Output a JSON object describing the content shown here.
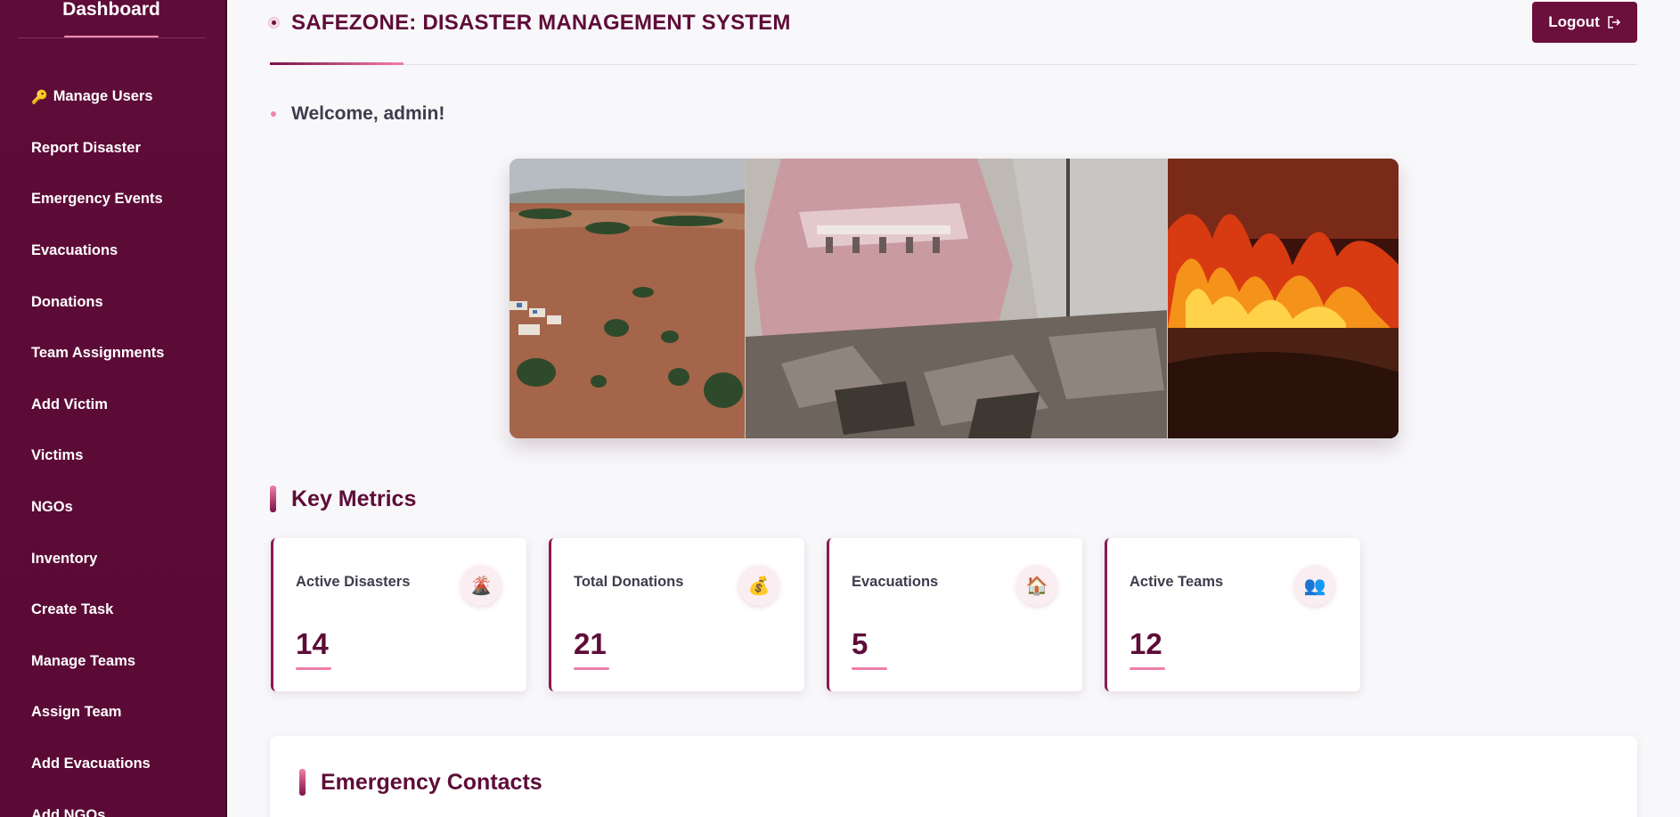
{
  "sidebar": {
    "title": "Dashboard",
    "items": [
      {
        "label": "Manage Users",
        "icon": "key-icon"
      },
      {
        "label": "Report Disaster"
      },
      {
        "label": "Emergency Events"
      },
      {
        "label": "Evacuations"
      },
      {
        "label": "Donations"
      },
      {
        "label": "Team Assignments"
      },
      {
        "label": "Add Victim"
      },
      {
        "label": "Victims"
      },
      {
        "label": "NGOs"
      },
      {
        "label": "Inventory"
      },
      {
        "label": "Create Task"
      },
      {
        "label": "Manage Teams"
      },
      {
        "label": "Assign Team"
      },
      {
        "label": "Add Evacuations"
      },
      {
        "label": "Add NGOs"
      }
    ]
  },
  "header": {
    "title": "SAFEZONE: DISASTER MANAGEMENT SYSTEM",
    "logout_label": "Logout"
  },
  "welcome": "Welcome, admin!",
  "key_metrics": {
    "title": "Key Metrics",
    "cards": [
      {
        "label": "Active Disasters",
        "value": "14",
        "icon": "volcano-icon"
      },
      {
        "label": "Total Donations",
        "value": "21",
        "icon": "money-bag-icon"
      },
      {
        "label": "Evacuations",
        "value": "5",
        "icon": "house-icon"
      },
      {
        "label": "Active Teams",
        "value": "12",
        "icon": "people-icon"
      }
    ]
  },
  "contacts": {
    "title": "Emergency Contacts"
  },
  "colors": {
    "primary": "#5e0c38",
    "accent": "#f07ea9",
    "button": "#6b0f3c"
  }
}
